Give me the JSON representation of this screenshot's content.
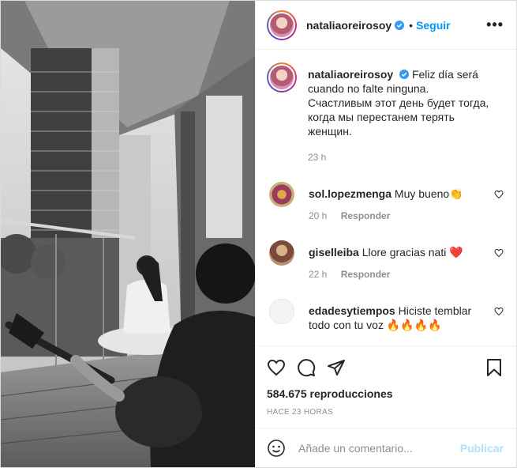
{
  "post": {
    "username": "nataliaoreirosoy",
    "follow_label": "Seguir",
    "dot": "•",
    "more_label": "•••",
    "caption_lines": [
      "Feliz día será",
      "cuando no falte ninguna."
    ],
    "caption_ru": [
      "Счастливым этот день будет тогда,",
      "когда мы перестанем терять",
      "женщин."
    ],
    "caption_time": "23 h"
  },
  "comments": [
    {
      "username": "sol.lopezmenga",
      "text": "Muy bueno👏",
      "time": "20 h",
      "reply": "Responder"
    },
    {
      "username": "giselleiba",
      "text": "Llore gracias nati ❤️",
      "time": "22 h",
      "reply": "Responder"
    },
    {
      "username": "edadesytiempos",
      "text": "Hiciste temblar todo con tu voz 🔥🔥🔥🔥"
    }
  ],
  "stats": {
    "views_count": "584.675",
    "views_label": "reproducciones",
    "posted_ago": "HACE 23 HORAS"
  },
  "composer": {
    "placeholder": "Añade un comentario...",
    "publish_label": "Publicar"
  },
  "colors": {
    "link_blue": "#0095f6",
    "disabled_blue": "#b2dffc",
    "muted": "#8e8e8e"
  }
}
